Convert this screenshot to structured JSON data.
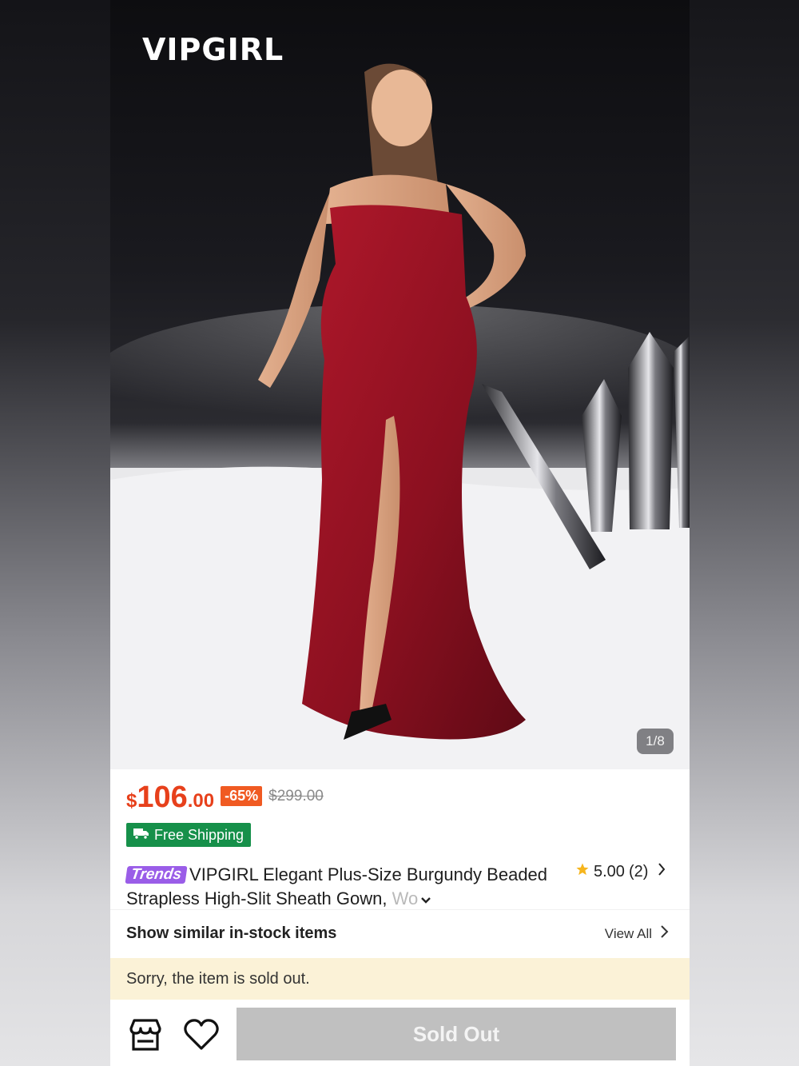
{
  "brand": "VIPGIRL",
  "gallery": {
    "indicator": "1/8"
  },
  "price": {
    "currency": "$",
    "integer": "106",
    "decimal": ".00",
    "discount": "-65%",
    "original": "$299.00",
    "color": "#e7401b"
  },
  "shipping": {
    "label": "Free Shipping",
    "icon": "truck-icon",
    "color": "#16904a"
  },
  "product": {
    "badge": "Trends",
    "title_main": "VIPGIRL Elegant Plus-Size Burgundy Beaded Strapless High-Slit Sheath Gown, ",
    "title_fade": "Wo"
  },
  "rating": {
    "score": "5.00",
    "count": "(2)"
  },
  "similar": {
    "label": "Show similar in-stock items",
    "view_all": "View All"
  },
  "notice": "Sorry, the item is sold out.",
  "actions": {
    "primary": "Sold Out",
    "store_icon": "store-icon",
    "wishlist_icon": "heart-icon"
  }
}
